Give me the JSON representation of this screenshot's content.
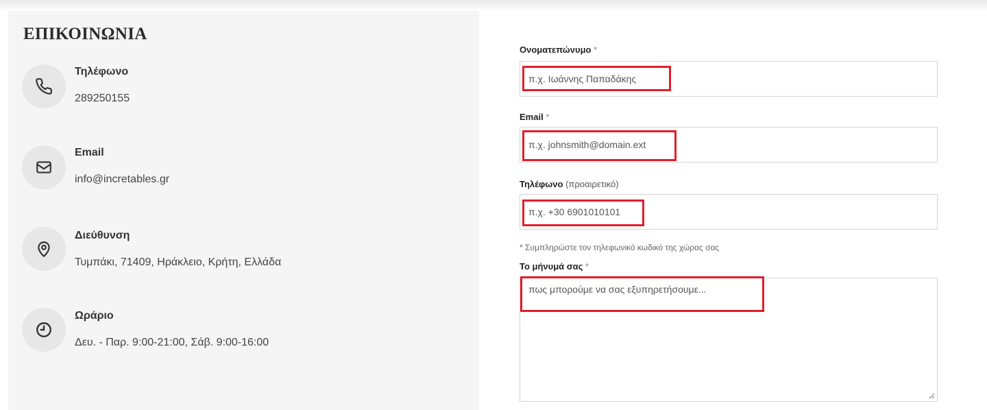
{
  "contact": {
    "title": "ΕΠΙΚΟΙΝΩΝΙΑ",
    "items": [
      {
        "label": "Τηλέφωνο",
        "value": "289250155",
        "icon": "phone-icon"
      },
      {
        "label": "Email",
        "value": "info@incretables.gr",
        "icon": "mail-icon"
      },
      {
        "label": "Διεύθυνση",
        "value": "Τυμπάκι, 71409, Ηράκλειο, Κρήτη, Ελλάδα",
        "icon": "location-pin-icon"
      },
      {
        "label": "Ωράριο",
        "value": "Δευ. - Παρ. 9:00-21:00, Σάβ. 9:00-16:00",
        "icon": "clock-icon"
      }
    ]
  },
  "form": {
    "name": {
      "label": "Ονοματεπώνυμο",
      "required": "*",
      "placeholder": "π.χ. Ιωάννης Παπαδάκης"
    },
    "email": {
      "label": "Email",
      "required": "*",
      "placeholder": "π.χ. johnsmith@domain.ext"
    },
    "phone": {
      "label": "Τηλέφωνο",
      "optional": "(προαιρετικό)",
      "placeholder": "π.χ. +30 6901010101",
      "hint": "* Συμπληρώστε τον τηλεφωνικό κωδικό της χώρας σας"
    },
    "message": {
      "label": "Το μήνυμά σας",
      "required": "*",
      "placeholder": "πως μπορούμε να σας εξυπηρετήσουμε..."
    }
  },
  "colors": {
    "highlight": "#e01e2c",
    "panel": "#f5f5f5",
    "icon_circle": "#e7e7e7"
  }
}
